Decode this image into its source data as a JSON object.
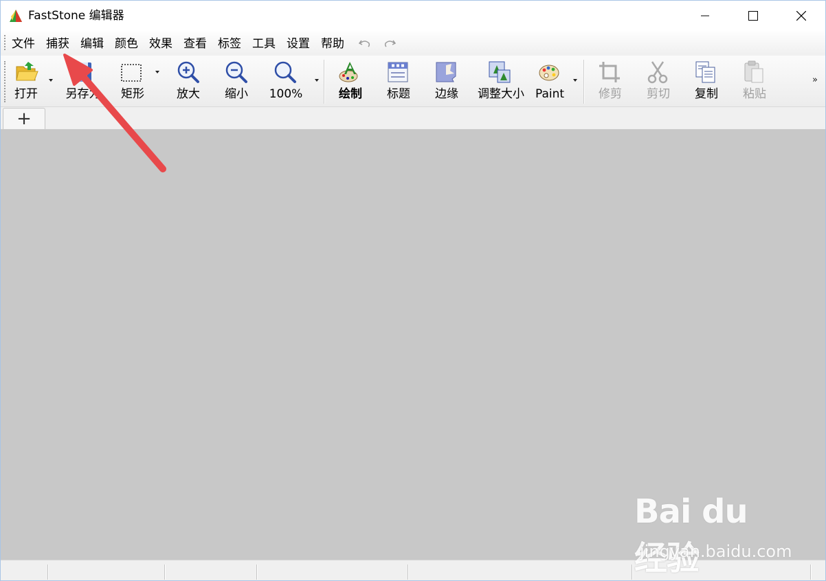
{
  "window": {
    "title": "FastStone 编辑器"
  },
  "menu": [
    "文件",
    "捕获",
    "编辑",
    "颜色",
    "效果",
    "查看",
    "标签",
    "工具",
    "设置",
    "帮助"
  ],
  "toolbar": {
    "open": "打开",
    "save_as": "另存为",
    "rectangle": "矩形",
    "zoom_in": "放大",
    "zoom_out": "缩小",
    "zoom_100": "100%",
    "draw": "绘制",
    "caption": "标题",
    "edge": "边缘",
    "resize": "调整大小",
    "paint": "Paint",
    "crop": "修剪",
    "cut": "剪切",
    "copy": "复制",
    "paste": "粘贴",
    "overflow": "»"
  },
  "tabs": {
    "add_label": "+"
  },
  "watermark": {
    "logo": "Bai du 经验",
    "url": "jingyan.baidu.com"
  },
  "colors": {
    "annotation_arrow": "#e8494b",
    "canvas_bg": "#c8c8c8",
    "disabled_text": "#a0a0a0"
  }
}
